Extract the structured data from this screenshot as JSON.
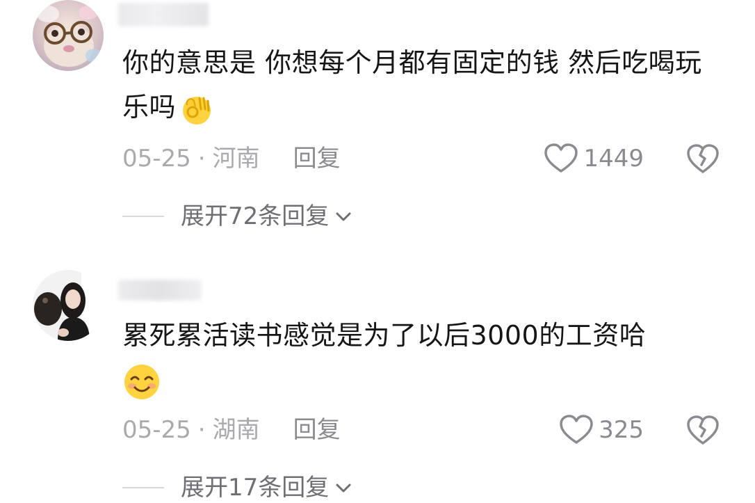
{
  "comments": [
    {
      "text": "你的意思是 你想每个月都有固定的钱 然后吃喝玩乐吗",
      "emoji": "ok-hand-emoji",
      "date": "05-25",
      "separator": "·",
      "location": "河南",
      "reply_label": "回复",
      "likes": "1449",
      "expand_label": "展开72条回复"
    },
    {
      "text": "累死累活读书感觉是为了以后3000的工资哈",
      "emoji": "smiling-face-emoji",
      "date": "05-25",
      "separator": "·",
      "location": "湖南",
      "reply_label": "回复",
      "likes": "325",
      "expand_label": "展开17条回复"
    }
  ],
  "colors": {
    "text": "#161616",
    "meta": "#a9a9ae",
    "action": "#8a8a90",
    "expand": "#6e6e74"
  }
}
